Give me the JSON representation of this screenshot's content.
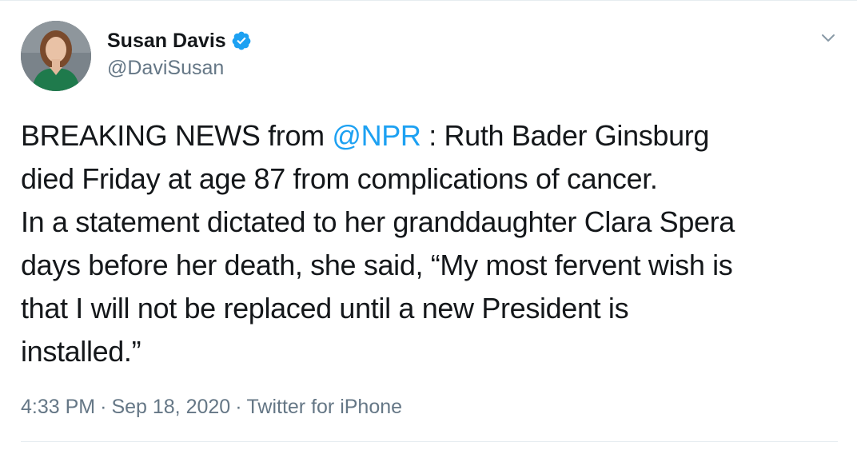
{
  "author": {
    "display_name": "Susan Davis",
    "handle": "@DaviSusan",
    "verified": true
  },
  "tweet": {
    "lines": [
      {
        "before": "BREAKING NEWS from ",
        "mention": "@NPR",
        "after": " : Ruth Bader Ginsburg"
      },
      {
        "text": "died Friday at age 87 from complications of cancer."
      },
      {
        "text": "In a statement dictated to her granddaughter Clara Spera"
      },
      {
        "text": "days before her death, she said, “My most fervent wish is"
      },
      {
        "text": "that I will not be replaced until a new President is"
      },
      {
        "text": "installed.”"
      }
    ]
  },
  "meta": {
    "time": "4:33 PM",
    "date": "Sep 18, 2020",
    "source": "Twitter for iPhone",
    "separator": "·"
  },
  "icons": {
    "verified": "verified-badge-icon",
    "caret": "chevron-down-icon",
    "avatar": "profile-photo"
  },
  "colors": {
    "link": "#1da1f2",
    "text": "#14171a",
    "secondary": "#657786",
    "verified": "#1da1f2",
    "border": "#e6ecf0"
  }
}
